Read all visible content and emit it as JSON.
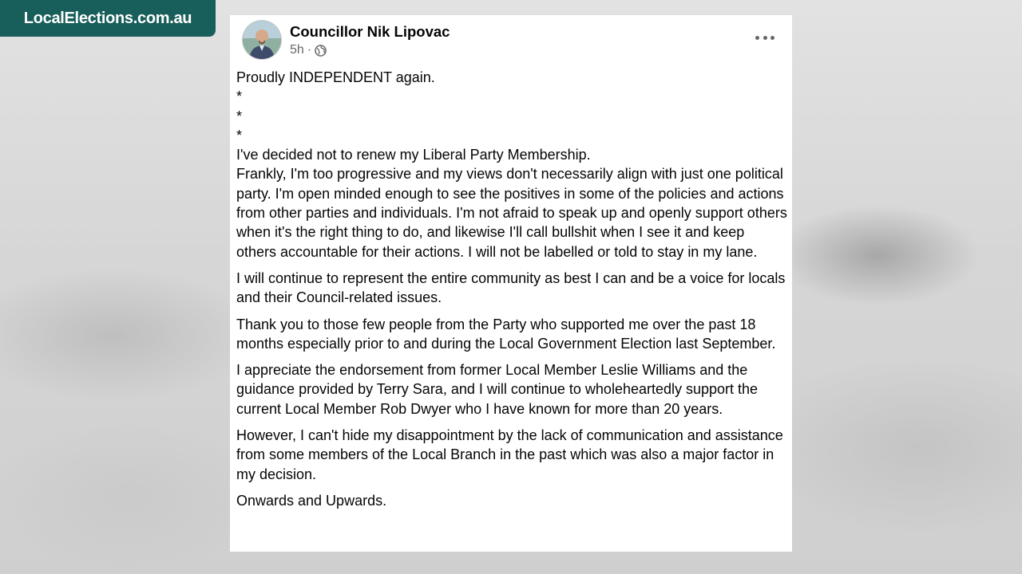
{
  "site_badge": {
    "text": "LocalElections.com.au"
  },
  "post": {
    "author": "Councillor Nik Lipovac",
    "timestamp": "5h",
    "separator": "·",
    "audience_icon": "globe-icon",
    "more_icon": "more-options-icon",
    "lines": [
      "Proudly INDEPENDENT again.",
      "*",
      "*",
      "*",
      "I've decided not to renew my Liberal Party Membership."
    ],
    "paragraphs": [
      "Frankly, I'm too progressive and my views don't necessarily align with just one political party. I'm open minded enough to see the positives in some of the policies and actions from other parties and individuals. I'm not afraid to speak up and openly support others when it's the right thing to do, and likewise I'll call bullshit when I see it and keep others accountable for their actions. I will not be labelled or told to stay in my lane.",
      "I will continue to represent the entire community as best I can and be a voice for locals and their Council-related issues.",
      "Thank you to those few people from the Party who supported me over the past 18 months especially prior to and during the Local Government Election last September.",
      "I appreciate the endorsement from former Local Member Leslie Williams and the guidance provided by Terry Sara, and I will continue to wholeheartedly support the current Local Member Rob Dwyer who I have known for more than 20 years.",
      "However, I can't hide my disappointment by the lack of communication and assistance from some members of the Local Branch in the past which was also a major factor in my decision.",
      "Onwards and Upwards."
    ]
  },
  "colors": {
    "badge_bg": "#185e5a",
    "text_primary": "#050505",
    "text_secondary": "#65676b"
  }
}
